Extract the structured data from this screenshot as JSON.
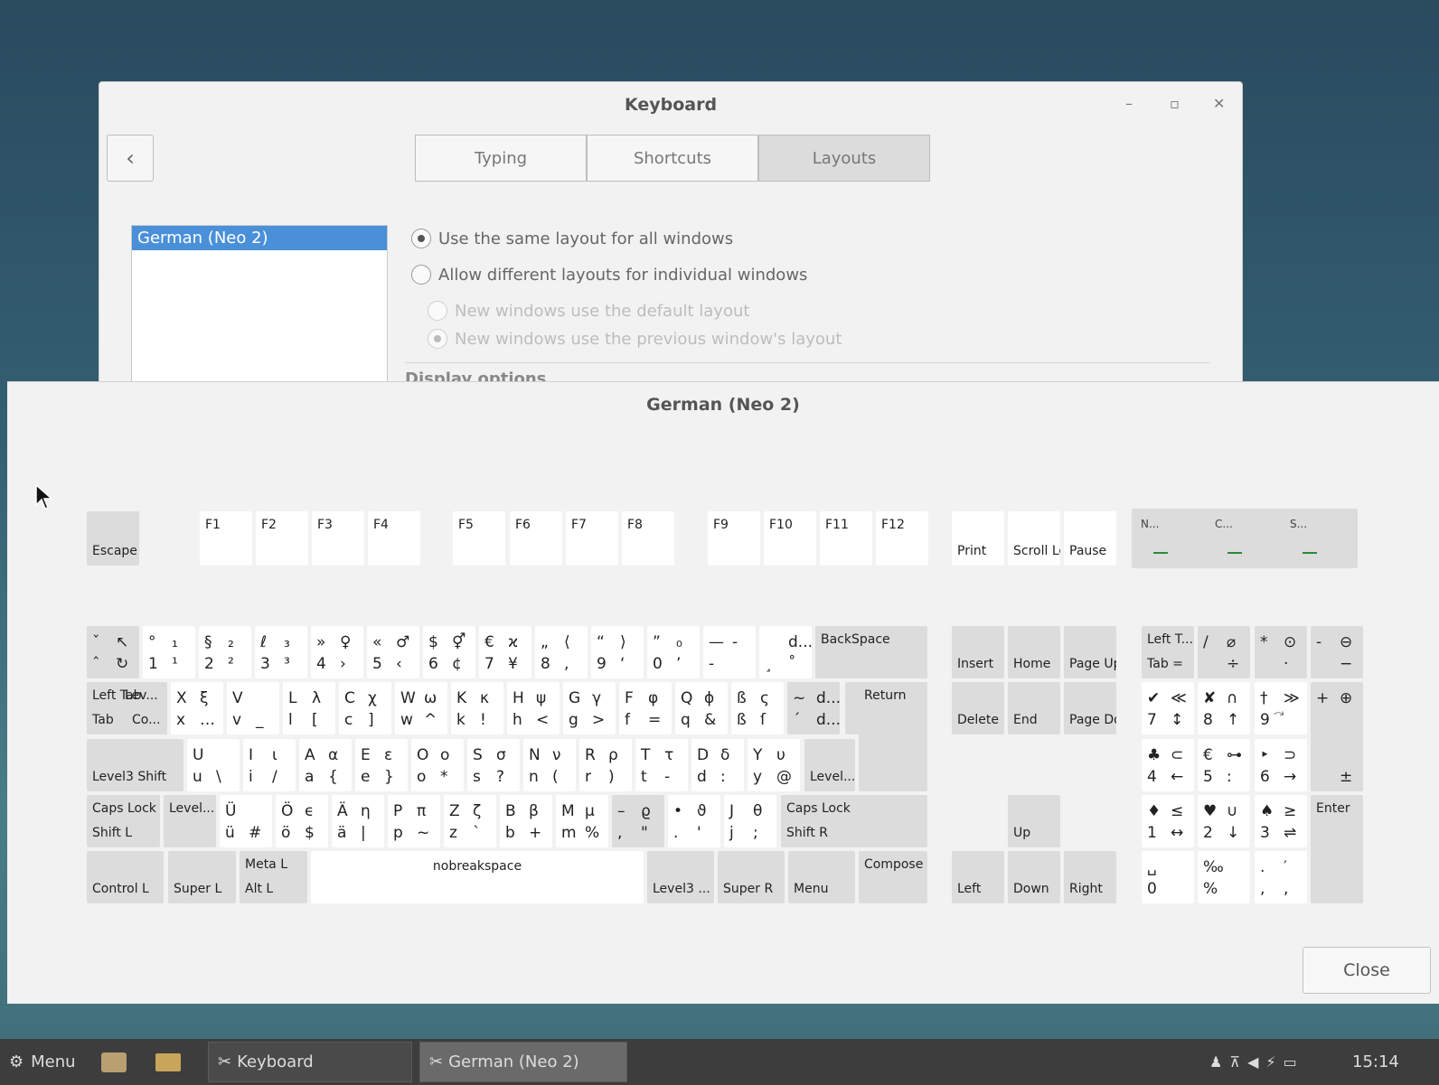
{
  "settings": {
    "title": "Keyboard",
    "tabs": [
      "Typing",
      "Shortcuts",
      "Layouts"
    ],
    "layout_selected": "German (Neo 2)",
    "options": [
      "Use the same layout for all windows",
      "Allow different layouts for individual windows",
      "New windows use the default layout",
      "New windows use the previous window's layout"
    ],
    "section": "Display options"
  },
  "preview": {
    "title": "German (Neo 2)",
    "close_label": "Close",
    "fn_row": {
      "escape": "Escape",
      "f": [
        "F1",
        "F2",
        "F3",
        "F4",
        "F5",
        "F6",
        "F7",
        "F8",
        "F9",
        "F10",
        "F11",
        "F12"
      ],
      "print": "Print",
      "scroll_lock": "Scroll Lock",
      "pause": "Pause",
      "leds": [
        "N...",
        "C...",
        "S..."
      ]
    },
    "number_row": [
      {
        "t1": "ˇ",
        "t2": "↖",
        "b1": "ˆ",
        "b2": "↻"
      },
      {
        "t1": "°",
        "t2": "₁",
        "b1": "1",
        "b2": "¹"
      },
      {
        "t1": "§",
        "t2": "₂",
        "b1": "2",
        "b2": "²"
      },
      {
        "t1": "ℓ",
        "t2": "₃",
        "b1": "3",
        "b2": "³"
      },
      {
        "t1": "»",
        "t2": "♀",
        "b1": "4",
        "b2": "›"
      },
      {
        "t1": "«",
        "t2": "♂",
        "b1": "5",
        "b2": "‹"
      },
      {
        "t1": "$",
        "t2": "⚥",
        "b1": "6",
        "b2": "¢"
      },
      {
        "t1": "€",
        "t2": "ϰ",
        "b1": "7",
        "b2": "¥"
      },
      {
        "t1": "„",
        "t2": "⟨",
        "b1": "8",
        "b2": ","
      },
      {
        "t1": "“",
        "t2": "⟩",
        "b1": "9",
        "b2": "‘"
      },
      {
        "t1": "”",
        "t2": "₀",
        "b1": "0",
        "b2": "’"
      },
      {
        "t1": "—",
        "t2": "-",
        "b1": "-",
        "b2": ""
      },
      {
        "t1": "",
        "t2": "d...",
        "b1": "¸",
        "b2": "˚"
      }
    ],
    "backspace": "BackSpace",
    "top_row": {
      "tab": {
        "tl": "Left Tab",
        "tr": "Lev...",
        "bl": "Tab",
        "br": "Co..."
      },
      "keys": [
        {
          "t1": "X",
          "t2": "ξ",
          "b1": "x",
          "b2": "…"
        },
        {
          "t1": "V",
          "t2": "",
          "b1": "v",
          "b2": "_"
        },
        {
          "t1": "L",
          "t2": "λ",
          "b1": "l",
          "b2": "["
        },
        {
          "t1": "C",
          "t2": "χ",
          "b1": "c",
          "b2": "]"
        },
        {
          "t1": "W",
          "t2": "ω",
          "b1": "w",
          "b2": "^"
        },
        {
          "t1": "K",
          "t2": "κ",
          "b1": "k",
          "b2": "!"
        },
        {
          "t1": "H",
          "t2": "ψ",
          "b1": "h",
          "b2": "<"
        },
        {
          "t1": "G",
          "t2": "γ",
          "b1": "g",
          "b2": ">"
        },
        {
          "t1": "F",
          "t2": "φ",
          "b1": "f",
          "b2": "="
        },
        {
          "t1": "Q",
          "t2": "ϕ",
          "b1": "q",
          "b2": "&"
        },
        {
          "t1": "ß",
          "t2": "ς",
          "b1": "ß",
          "b2": "ſ"
        },
        {
          "t1": "~",
          "t2": "d...",
          "b1": "´",
          "b2": "d..."
        }
      ]
    },
    "return": "Return",
    "home_row": {
      "left": "Level3 Shift",
      "keys": [
        {
          "t1": "U",
          "t2": "",
          "b1": "u",
          "b2": "\\"
        },
        {
          "t1": "I",
          "t2": "ι",
          "b1": "i",
          "b2": "/"
        },
        {
          "t1": "A",
          "t2": "α",
          "b1": "a",
          "b2": "{"
        },
        {
          "t1": "E",
          "t2": "ε",
          "b1": "e",
          "b2": "}"
        },
        {
          "t1": "O",
          "t2": "o",
          "b1": "o",
          "b2": "*"
        },
        {
          "t1": "S",
          "t2": "σ",
          "b1": "s",
          "b2": "?"
        },
        {
          "t1": "N",
          "t2": "ν",
          "b1": "n",
          "b2": "("
        },
        {
          "t1": "R",
          "t2": "ρ",
          "b1": "r",
          "b2": ")"
        },
        {
          "t1": "T",
          "t2": "τ",
          "b1": "t",
          "b2": "-"
        },
        {
          "t1": "D",
          "t2": "δ",
          "b1": "d",
          "b2": ":"
        },
        {
          "t1": "Y",
          "t2": "υ",
          "b1": "y",
          "b2": "@"
        }
      ],
      "level": "Level..."
    },
    "bottom_row": {
      "shift_l": {
        "top": "Caps Lock",
        "bottom": "Shift L"
      },
      "level": "Level...",
      "keys": [
        {
          "t1": "Ü",
          "t2": "",
          "b1": "ü",
          "b2": "#"
        },
        {
          "t1": "Ö",
          "t2": "ϵ",
          "b1": "ö",
          "b2": "$"
        },
        {
          "t1": "Ä",
          "t2": "η",
          "b1": "ä",
          "b2": "|"
        },
        {
          "t1": "P",
          "t2": "π",
          "b1": "p",
          "b2": "~"
        },
        {
          "t1": "Z",
          "t2": "ζ",
          "b1": "z",
          "b2": "`"
        },
        {
          "t1": "B",
          "t2": "β",
          "b1": "b",
          "b2": "+"
        },
        {
          "t1": "M",
          "t2": "μ",
          "b1": "m",
          "b2": "%"
        },
        {
          "t1": "–",
          "t2": "ϱ",
          "b1": ",",
          "b2": "\""
        },
        {
          "t1": "•",
          "t2": "ϑ",
          "b1": ".",
          "b2": "'"
        },
        {
          "t1": "J",
          "t2": "θ",
          "b1": "j",
          "b2": ";"
        }
      ],
      "shift_r": {
        "top": "Caps Lock",
        "bottom": "Shift R"
      }
    },
    "space_row": {
      "control_l": "Control L",
      "super_l": "Super L",
      "alt_l": {
        "top": "Meta L",
        "bottom": "Alt L"
      },
      "space": "nobreakspace",
      "level3": "Level3 ...",
      "super_r": "Super R",
      "menu": "Menu",
      "compose": "Compose"
    },
    "nav": {
      "insert": "Insert",
      "home": "Home",
      "page_up": "Page Up",
      "delete": "Delete",
      "end": "End",
      "page_down": "Page Down",
      "up": "Up",
      "left": "Left",
      "down": "Down",
      "right": "Right"
    },
    "numpad": {
      "numlock": {
        "top": "Left T...",
        "bottom": "Tab ="
      },
      "div": {
        "t1": "/",
        "t2": "⌀",
        "b2": "÷"
      },
      "mul": {
        "t1": "*",
        "t2": "⊙",
        "b2": "·"
      },
      "minus": {
        "t1": "-",
        "t2": "⊖",
        "b2": "−"
      },
      "k7": {
        "t1": "✔",
        "t2": "≪",
        "b1": "7",
        "b2": "↕"
      },
      "k8": {
        "t1": "✘",
        "t2": "∩",
        "b1": "8",
        "b2": "↑"
      },
      "k9": {
        "t1": "†",
        "t2": "≫",
        "b1": "9",
        "b2": "⃕"
      },
      "plus": {
        "t1": "+",
        "t2": "⊕",
        "b2": "±"
      },
      "k4": {
        "t1": "♣",
        "t2": "⊂",
        "b1": "4",
        "b2": "←"
      },
      "k5": {
        "t1": "€",
        "t2": "⊶",
        "b1": "5",
        "b2": ":"
      },
      "k6": {
        "t1": "‣",
        "t2": "⊃",
        "b1": "6",
        "b2": "→"
      },
      "k1": {
        "t1": "♦",
        "t2": "≤",
        "b1": "1",
        "b2": "↔"
      },
      "k2": {
        "t1": "♥",
        "t2": "∪",
        "b1": "2",
        "b2": "↓"
      },
      "k3": {
        "t1": "♠",
        "t2": "≥",
        "b1": "3",
        "b2": "⇌"
      },
      "enter": "Enter",
      "k0": {
        "t1": "␣",
        "b1": "0"
      },
      "k00": {
        "t1": "‰",
        "b1": "%"
      },
      "kdot": {
        "t1": ".",
        "t2": "′",
        "b1": ",",
        "b2": ","
      }
    }
  },
  "taskbar": {
    "menu_label": "Menu",
    "windows": [
      "Keyboard",
      "German (Neo 2)"
    ],
    "clock": "15:14"
  }
}
